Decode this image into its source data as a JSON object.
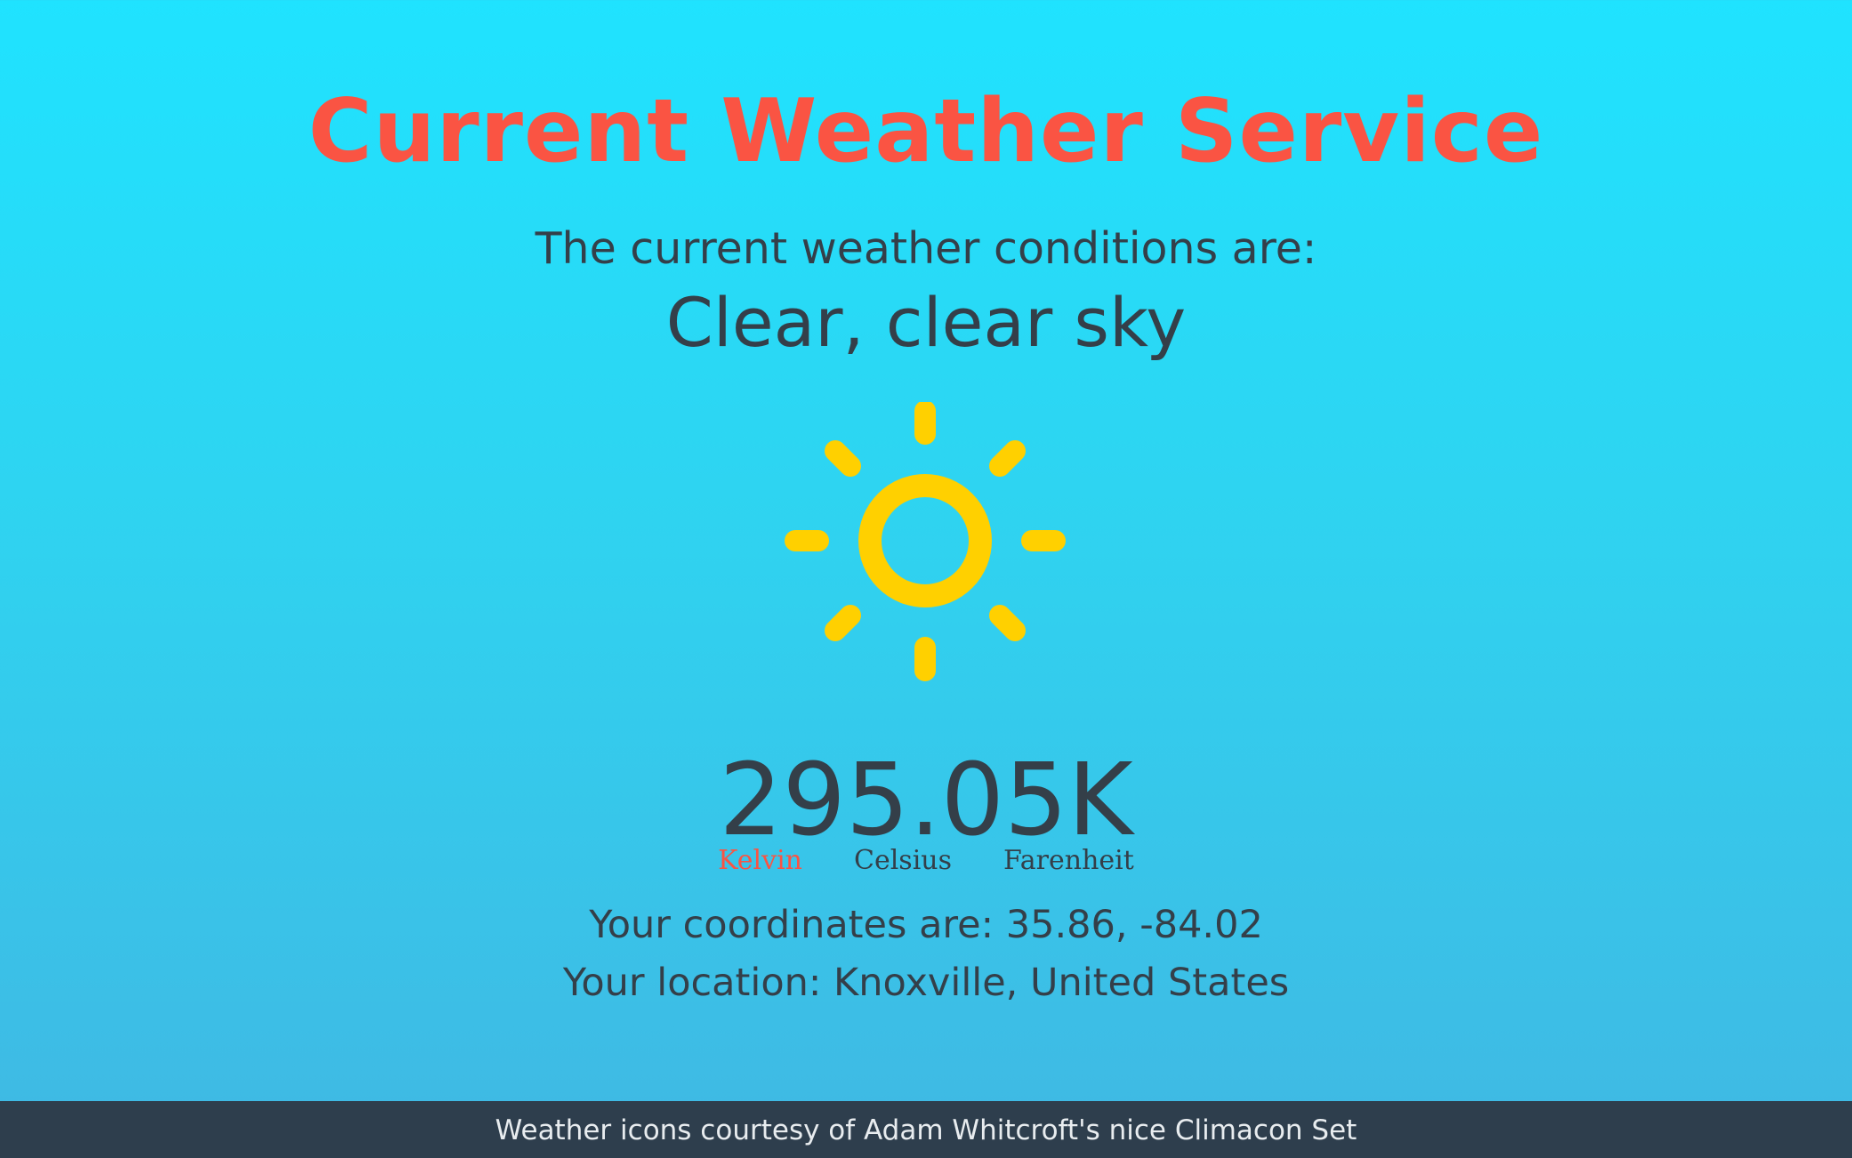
{
  "header": {
    "title": "Current Weather Service"
  },
  "weather": {
    "intro": "The current weather conditions are:",
    "conditions": "Clear, clear sky",
    "icon": "sun-icon",
    "temperature": "295.05K",
    "units": [
      {
        "label": "Kelvin",
        "active": true
      },
      {
        "label": "Celsius",
        "active": false
      },
      {
        "label": "Farenheit",
        "active": false
      }
    ],
    "coordinates": "Your coordinates are: 35.86, -84.02",
    "location": "Your location: Knoxville, United States"
  },
  "footer": {
    "credit": "Weather icons courtesy of Adam Whitcroft's nice Climacon Set"
  },
  "colors": {
    "accent": "#fa5443",
    "text": "#343f49",
    "sun": "#ffd000",
    "footer_bg": "#2e3e4d",
    "bg_top": "#1fe3ff",
    "bg_bottom": "#40b8e3"
  }
}
